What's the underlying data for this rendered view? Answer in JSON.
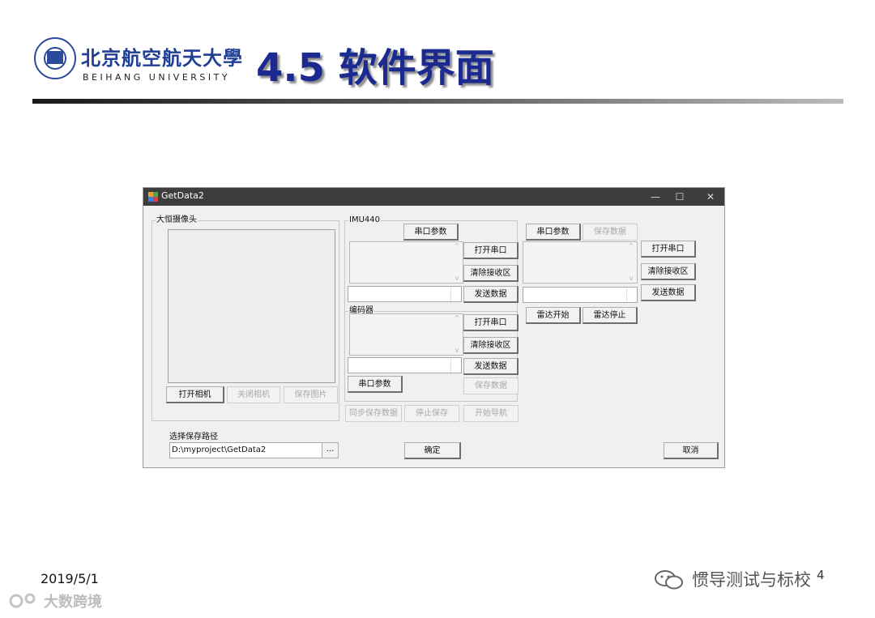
{
  "slide": {
    "university_cn": "北京航空航天大學",
    "university_en": "BEIHANG UNIVERSITY",
    "title": "4.5 软件界面",
    "date": "2019/5/1",
    "page": "4",
    "watermark": "惯导测试与标校",
    "signature": "大数跨境"
  },
  "window": {
    "title": "GetData2",
    "controls": {
      "minimize": "—",
      "maximize": "☐",
      "close": "✕"
    }
  },
  "camera": {
    "group_label": "大恒摄像头",
    "open_button": "打开相机",
    "close_button": "关闭相机",
    "save_button": "保存图片"
  },
  "path": {
    "label": "选择保存路径",
    "value": "D:\\myproject\\GetData2",
    "browse": "..."
  },
  "imu": {
    "group_label": "IMU440",
    "serial_params": "串口参数",
    "open_port": "打开串口",
    "clear_recv": "清除接收区",
    "send_data": "发送数据"
  },
  "encoder": {
    "group_label": "编码器",
    "open_port": "打开串口",
    "clear_recv": "清除接收区",
    "send_data": "发送数据",
    "serial_params": "串口参数",
    "save_data": "保存数据"
  },
  "sync": {
    "sync_save": "同步保存数据",
    "stop_save": "停止保存",
    "start_nav": "开始导航"
  },
  "radar": {
    "serial_params": "串口参数",
    "save_data": "保存数据",
    "open_port": "打开串口",
    "clear_recv": "清除接收区",
    "send_data": "发送数据",
    "start": "雷达开始",
    "stop": "雷达停止"
  },
  "dialog": {
    "ok": "确定",
    "cancel": "取消"
  }
}
